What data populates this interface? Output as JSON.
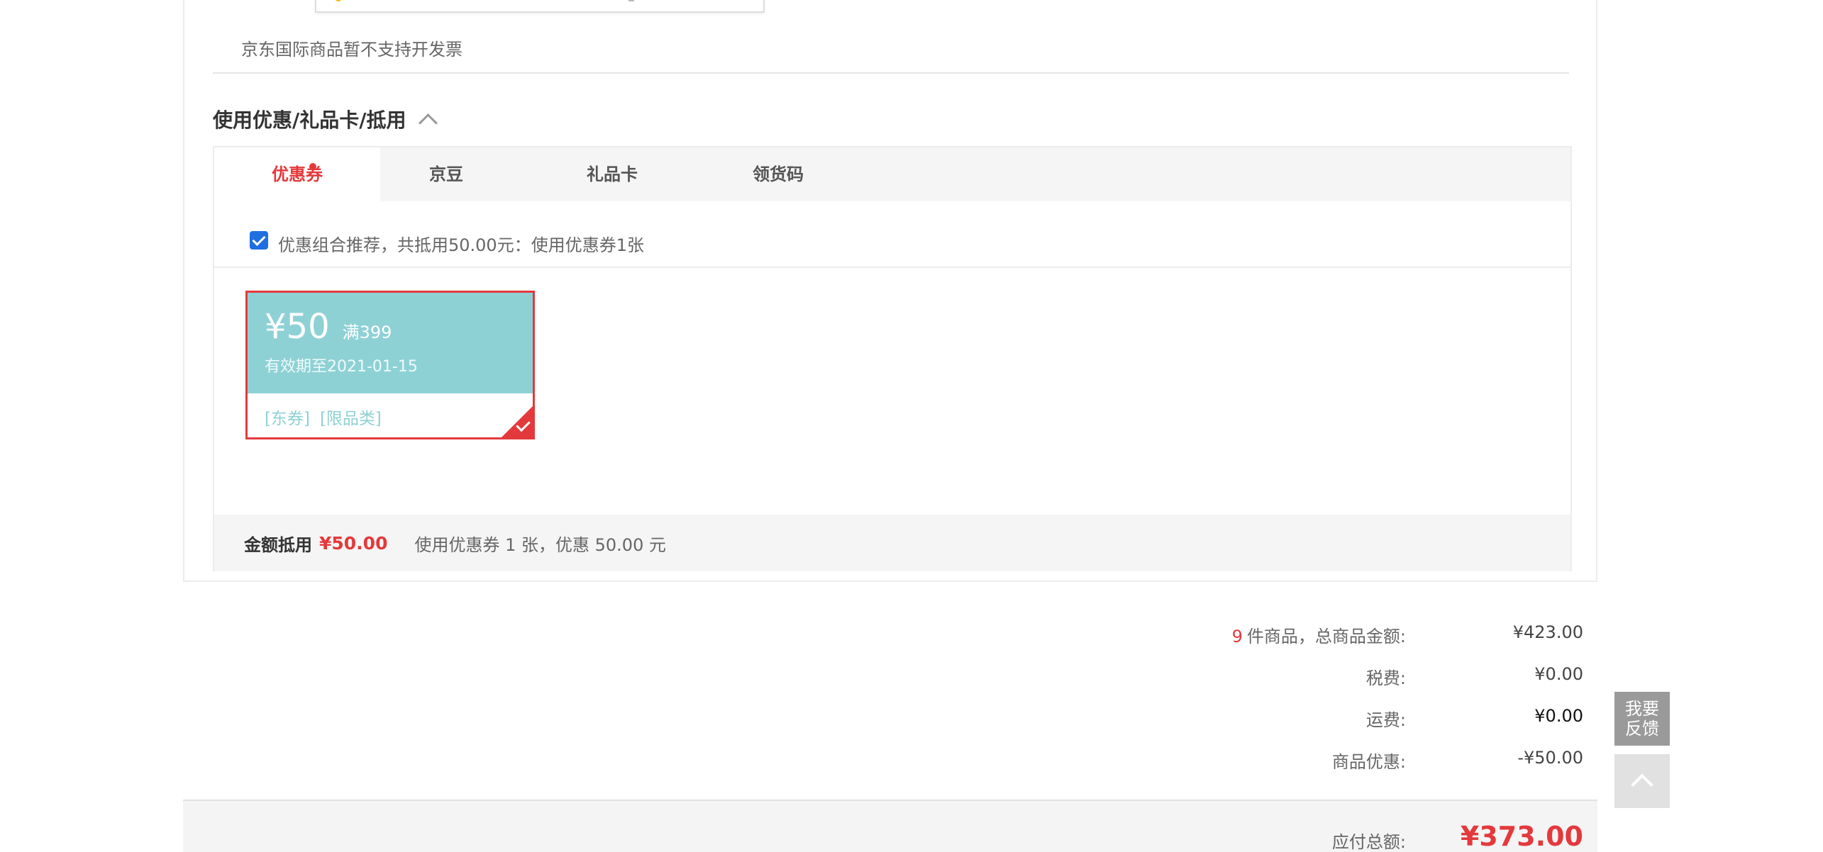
{
  "invoice": {
    "note": "京东国际商品暂不支持开发票"
  },
  "discount_section": {
    "title": "使用优惠/礼品卡/抵用",
    "tabs": [
      {
        "label": "优惠券",
        "active": true,
        "has_dot": true
      },
      {
        "label": "京豆",
        "active": false
      },
      {
        "label": "礼品卡",
        "active": false
      },
      {
        "label": "领货码",
        "active": false
      }
    ],
    "combo_recommend": {
      "checked": true,
      "text": "优惠组合推荐，共抵用50.00元：使用优惠券1张"
    },
    "coupon": {
      "amount": "¥50",
      "condition": "满399",
      "validity": "有效期至2021-01-15",
      "tags": [
        "[东券]",
        "[限品类]"
      ],
      "selected": true
    },
    "summary": {
      "label": "金额抵用",
      "value": "¥50.00",
      "desc": "使用优惠券 1 张，优惠 50.00 元"
    }
  },
  "totals": {
    "item_count": "9",
    "items_label": "件商品，总商品金额:",
    "items_value": "¥423.00",
    "tax_label": "税费:",
    "tax_value": "¥0.00",
    "shipping_label": "运费:",
    "shipping_value": "¥0.00",
    "discount_label": "商品优惠:",
    "discount_value": "-¥50.00",
    "payable_label": "应付总额:",
    "payable_value": "¥373.00"
  },
  "floating": {
    "feedback_line1": "我要",
    "feedback_line2": "反馈"
  },
  "colors": {
    "accent_red": "#e4393c",
    "coupon_teal": "#8ed1d5",
    "checkbox_blue": "#1f6fe0"
  }
}
